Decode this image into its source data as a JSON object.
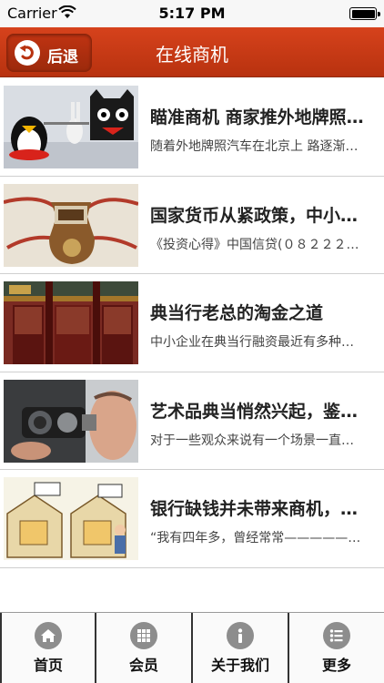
{
  "status_bar": {
    "carrier": "Carrier",
    "time": "5:17 PM"
  },
  "nav": {
    "back_label": "后退",
    "title": "在线商机"
  },
  "items": [
    {
      "title": "瞄准商机 商家推外地牌照汽车在北京上路",
      "summary": "随着外地牌照汽车在北京上 路逐渐增多"
    },
    {
      "title": "国家货币从紧政策，中小企业融资难",
      "summary": "《投资心得》中国信贷(０８２２２２２２)"
    },
    {
      "title": "典当行老总的淘金之道",
      "summary": "中小企业在典当行融资最近有多种新变化"
    },
    {
      "title": "艺术品典当悄然兴起，鉴定难题",
      "summary": "对于一些观众来说有一个场景一直记忆犹新"
    },
    {
      "title": "银行缺钱并未带来商机，民间借贷",
      "summary": "“我有四年多，曾经常常———————"
    }
  ],
  "tabs": [
    {
      "label": "首页",
      "icon": "home-icon"
    },
    {
      "label": "会员",
      "icon": "grid-icon"
    },
    {
      "label": "关于我们",
      "icon": "info-icon"
    },
    {
      "label": "更多",
      "icon": "list-icon"
    }
  ],
  "colors": {
    "nav_red": "#c83a16",
    "tab_icon": "#8d8d8d"
  }
}
